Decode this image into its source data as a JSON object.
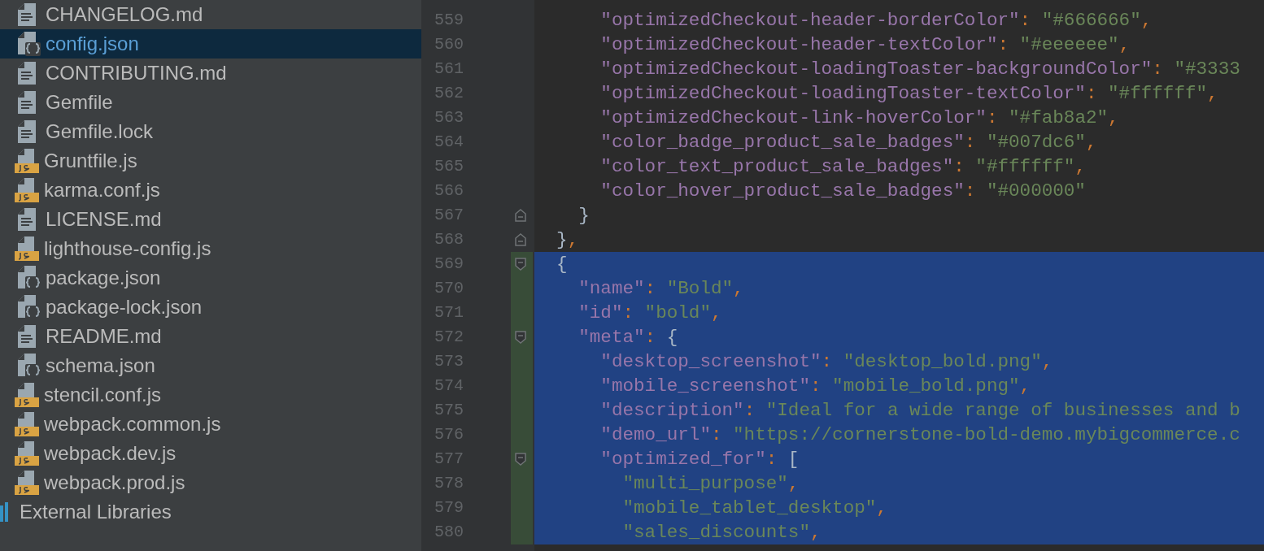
{
  "project_tree": {
    "items": [
      {
        "label": "CHANGELOG.md",
        "kind": "text",
        "selected": false
      },
      {
        "label": "config.json",
        "kind": "json",
        "selected": true
      },
      {
        "label": "CONTRIBUTING.md",
        "kind": "text",
        "selected": false
      },
      {
        "label": "Gemfile",
        "kind": "text",
        "selected": false
      },
      {
        "label": "Gemfile.lock",
        "kind": "text",
        "selected": false
      },
      {
        "label": "Gruntfile.js",
        "kind": "js",
        "selected": false
      },
      {
        "label": "karma.conf.js",
        "kind": "js",
        "selected": false
      },
      {
        "label": "LICENSE.md",
        "kind": "text",
        "selected": false
      },
      {
        "label": "lighthouse-config.js",
        "kind": "js",
        "selected": false
      },
      {
        "label": "package.json",
        "kind": "json",
        "selected": false
      },
      {
        "label": "package-lock.json",
        "kind": "json",
        "selected": false
      },
      {
        "label": "README.md",
        "kind": "text",
        "selected": false
      },
      {
        "label": "schema.json",
        "kind": "json",
        "selected": false
      },
      {
        "label": "stencil.conf.js",
        "kind": "js",
        "selected": false
      },
      {
        "label": "webpack.common.js",
        "kind": "js",
        "selected": false
      },
      {
        "label": "webpack.dev.js",
        "kind": "js",
        "selected": false
      },
      {
        "label": "webpack.prod.js",
        "kind": "js",
        "selected": false
      },
      {
        "label": "External Libraries",
        "kind": "library",
        "selected": false
      }
    ]
  },
  "editor": {
    "lines": [
      {
        "number": "559",
        "fold_start": false,
        "fold_end": false,
        "added": false,
        "selected": false,
        "tokens": [
          {
            "kind": "key",
            "text": "      \"optimizedCheckout-header-borderColor\""
          },
          {
            "kind": "punct",
            "text": ": "
          },
          {
            "kind": "string",
            "text": "\"#666666\""
          },
          {
            "kind": "punct",
            "text": ","
          }
        ]
      },
      {
        "number": "560",
        "fold_start": false,
        "fold_end": false,
        "added": false,
        "selected": false,
        "tokens": [
          {
            "kind": "key",
            "text": "      \"optimizedCheckout-header-textColor\""
          },
          {
            "kind": "punct",
            "text": ": "
          },
          {
            "kind": "string",
            "text": "\"#eeeeee\""
          },
          {
            "kind": "punct",
            "text": ","
          }
        ]
      },
      {
        "number": "561",
        "fold_start": false,
        "fold_end": false,
        "added": false,
        "selected": false,
        "tokens": [
          {
            "kind": "key",
            "text": "      \"optimizedCheckout-loadingToaster-backgroundColor\""
          },
          {
            "kind": "punct",
            "text": ": "
          },
          {
            "kind": "string",
            "text": "\"#3333"
          }
        ]
      },
      {
        "number": "562",
        "fold_start": false,
        "fold_end": false,
        "added": false,
        "selected": false,
        "tokens": [
          {
            "kind": "key",
            "text": "      \"optimizedCheckout-loadingToaster-textColor\""
          },
          {
            "kind": "punct",
            "text": ": "
          },
          {
            "kind": "string",
            "text": "\"#ffffff\""
          },
          {
            "kind": "punct",
            "text": ","
          }
        ]
      },
      {
        "number": "563",
        "fold_start": false,
        "fold_end": false,
        "added": false,
        "selected": false,
        "tokens": [
          {
            "kind": "key",
            "text": "      \"optimizedCheckout-link-hoverColor\""
          },
          {
            "kind": "punct",
            "text": ": "
          },
          {
            "kind": "string",
            "text": "\"#fab8a2\""
          },
          {
            "kind": "punct",
            "text": ","
          }
        ]
      },
      {
        "number": "564",
        "fold_start": false,
        "fold_end": false,
        "added": false,
        "selected": false,
        "tokens": [
          {
            "kind": "key",
            "text": "      \"color_badge_product_sale_badges\""
          },
          {
            "kind": "punct",
            "text": ": "
          },
          {
            "kind": "string",
            "text": "\"#007dc6\""
          },
          {
            "kind": "punct",
            "text": ","
          }
        ]
      },
      {
        "number": "565",
        "fold_start": false,
        "fold_end": false,
        "added": false,
        "selected": false,
        "tokens": [
          {
            "kind": "key",
            "text": "      \"color_text_product_sale_badges\""
          },
          {
            "kind": "punct",
            "text": ": "
          },
          {
            "kind": "string",
            "text": "\"#ffffff\""
          },
          {
            "kind": "punct",
            "text": ","
          }
        ]
      },
      {
        "number": "566",
        "fold_start": false,
        "fold_end": false,
        "added": false,
        "selected": false,
        "tokens": [
          {
            "kind": "key",
            "text": "      \"color_hover_product_sale_badges\""
          },
          {
            "kind": "punct",
            "text": ": "
          },
          {
            "kind": "string",
            "text": "\"#000000\""
          }
        ]
      },
      {
        "number": "567",
        "fold_start": false,
        "fold_end": true,
        "added": false,
        "selected": false,
        "tokens": [
          {
            "kind": "plain",
            "text": "    }"
          }
        ]
      },
      {
        "number": "568",
        "fold_start": false,
        "fold_end": true,
        "added": false,
        "selected": false,
        "tokens": [
          {
            "kind": "plain",
            "text": "  }"
          },
          {
            "kind": "punct",
            "text": ","
          }
        ]
      },
      {
        "number": "569",
        "fold_start": true,
        "fold_end": false,
        "added": true,
        "selected": true,
        "tokens": [
          {
            "kind": "plain",
            "text": "  {"
          }
        ]
      },
      {
        "number": "570",
        "fold_start": false,
        "fold_end": false,
        "added": true,
        "selected": true,
        "tokens": [
          {
            "kind": "key",
            "text": "    \"name\""
          },
          {
            "kind": "punct",
            "text": ": "
          },
          {
            "kind": "string",
            "text": "\"Bold\""
          },
          {
            "kind": "punct",
            "text": ","
          }
        ]
      },
      {
        "number": "571",
        "fold_start": false,
        "fold_end": false,
        "added": true,
        "selected": true,
        "tokens": [
          {
            "kind": "key",
            "text": "    \"id\""
          },
          {
            "kind": "punct",
            "text": ": "
          },
          {
            "kind": "string",
            "text": "\"bold\""
          },
          {
            "kind": "punct",
            "text": ","
          }
        ]
      },
      {
        "number": "572",
        "fold_start": true,
        "fold_end": false,
        "added": true,
        "selected": true,
        "tokens": [
          {
            "kind": "key",
            "text": "    \"meta\""
          },
          {
            "kind": "punct",
            "text": ": "
          },
          {
            "kind": "plain",
            "text": "{"
          }
        ]
      },
      {
        "number": "573",
        "fold_start": false,
        "fold_end": false,
        "added": true,
        "selected": true,
        "tokens": [
          {
            "kind": "key",
            "text": "      \"desktop_screenshot\""
          },
          {
            "kind": "punct",
            "text": ": "
          },
          {
            "kind": "string",
            "text": "\"desktop_bold.png\""
          },
          {
            "kind": "punct",
            "text": ","
          }
        ]
      },
      {
        "number": "574",
        "fold_start": false,
        "fold_end": false,
        "added": true,
        "selected": true,
        "tokens": [
          {
            "kind": "key",
            "text": "      \"mobile_screenshot\""
          },
          {
            "kind": "punct",
            "text": ": "
          },
          {
            "kind": "string",
            "text": "\"mobile_bold.png\""
          },
          {
            "kind": "punct",
            "text": ","
          }
        ]
      },
      {
        "number": "575",
        "fold_start": false,
        "fold_end": false,
        "added": true,
        "selected": true,
        "tokens": [
          {
            "kind": "key",
            "text": "      \"description\""
          },
          {
            "kind": "punct",
            "text": ": "
          },
          {
            "kind": "string",
            "text": "\"Ideal for a wide range of businesses and b"
          }
        ]
      },
      {
        "number": "576",
        "fold_start": false,
        "fold_end": false,
        "added": true,
        "selected": true,
        "tokens": [
          {
            "kind": "key",
            "text": "      \"demo_url\""
          },
          {
            "kind": "punct",
            "text": ": "
          },
          {
            "kind": "string",
            "text": "\"https://cornerstone-bold-demo.mybigcommerce.c"
          }
        ]
      },
      {
        "number": "577",
        "fold_start": true,
        "fold_end": false,
        "added": true,
        "selected": true,
        "tokens": [
          {
            "kind": "key",
            "text": "      \"optimized_for\""
          },
          {
            "kind": "punct",
            "text": ": "
          },
          {
            "kind": "plain",
            "text": "["
          }
        ]
      },
      {
        "number": "578",
        "fold_start": false,
        "fold_end": false,
        "added": true,
        "selected": true,
        "tokens": [
          {
            "kind": "string",
            "text": "        \"multi_purpose\""
          },
          {
            "kind": "punct",
            "text": ","
          }
        ]
      },
      {
        "number": "579",
        "fold_start": false,
        "fold_end": false,
        "added": true,
        "selected": true,
        "tokens": [
          {
            "kind": "string",
            "text": "        \"mobile_tablet_desktop\""
          },
          {
            "kind": "punct",
            "text": ","
          }
        ]
      },
      {
        "number": "580",
        "fold_start": false,
        "fold_end": false,
        "added": true,
        "selected": true,
        "tokens": [
          {
            "kind": "string",
            "text": "        \"sales_discounts\""
          },
          {
            "kind": "punct",
            "text": ","
          }
        ]
      }
    ]
  }
}
